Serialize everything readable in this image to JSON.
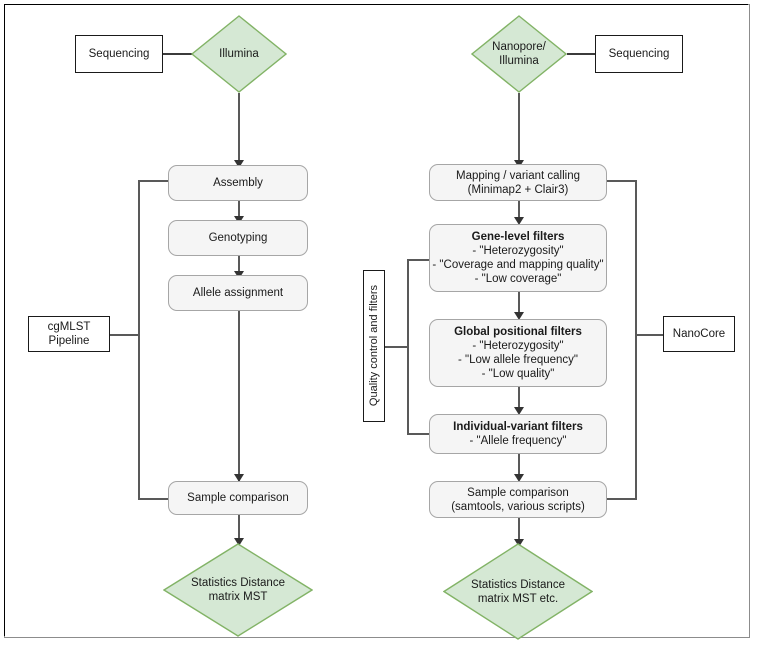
{
  "diagram": {
    "title": "Bacterial genomic pipeline comparison flowchart",
    "colors": {
      "diamond_fill": "#d5e8d4",
      "diamond_stroke": "#82b366",
      "process_fill": "#f5f5f5",
      "process_stroke": "#a6a6a6",
      "connector": "#595959",
      "text": "#1a1a1a"
    }
  },
  "left_branch": {
    "pipeline_label": "cgMLST\nPipeline",
    "pipeline_label_line1": "cgMLST",
    "pipeline_label_line2": "Pipeline",
    "sequencing_label": "Sequencing",
    "platform_label": "Illumina",
    "steps": [
      {
        "label": "Assembly"
      },
      {
        "label": "Genotyping"
      },
      {
        "label": "Allele assignment"
      },
      {
        "label": "Sample comparison"
      }
    ],
    "output": {
      "line1": "Statistics",
      "line2": "Distance matrix",
      "line3": "MST"
    }
  },
  "right_branch": {
    "pipeline_label": "NanoCore",
    "sequencing_label": "Sequencing",
    "platform_line1": "Nanopore/",
    "platform_line2": "Illumina",
    "qc_label": "Quality control and filters",
    "mapping": {
      "line1": "Mapping / variant calling",
      "line2": "(Minimap2 + Clair3)"
    },
    "filters": [
      {
        "title": "Gene-level filters",
        "items": [
          "- \"Heterozygosity\"",
          "- \"Coverage and mapping quality\"",
          "- \"Low coverage\""
        ]
      },
      {
        "title": "Global positional filters",
        "items": [
          "- \"Heterozygosity\"",
          "- \"Low allele frequency\"",
          "- \"Low quality\""
        ]
      },
      {
        "title": "Individual-variant filters",
        "items": [
          "- \"Allele frequency\""
        ]
      }
    ],
    "comparison": {
      "line1": "Sample comparison",
      "line2": "(samtools, various scripts)"
    },
    "output": {
      "line1": "Statistics",
      "line2": "Distance matrix",
      "line3": "MST",
      "line4": "etc."
    }
  }
}
